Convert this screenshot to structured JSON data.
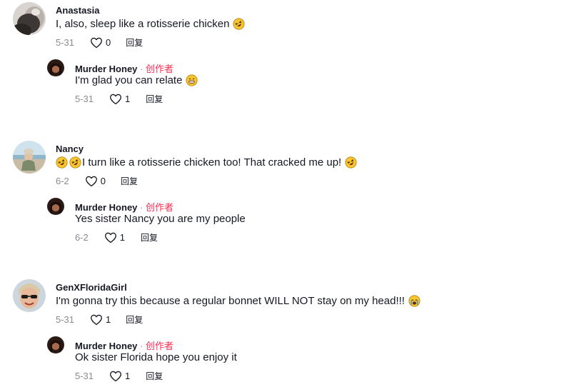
{
  "comments": [
    {
      "username": "Anastasia",
      "text": "I, also, sleep like a rotisserie chicken",
      "date": "5-31",
      "likes": "0",
      "reply_label": "回复",
      "reply": {
        "username": "Murder Honey",
        "separator": " · ",
        "badge": "创作者",
        "text": "I'm glad you can relate",
        "date": "5-31",
        "likes": "1",
        "reply_label": "回复"
      }
    },
    {
      "username": "Nancy",
      "text": "I turn like a rotisserie chicken too! That cracked me up!",
      "date": "6-2",
      "likes": "0",
      "reply_label": "回复",
      "reply": {
        "username": "Murder Honey",
        "separator": " · ",
        "badge": "创作者",
        "text": "Yes sister Nancy you are my people",
        "date": "6-2",
        "likes": "1",
        "reply_label": "回复"
      }
    },
    {
      "username": "GenXFloridaGirl",
      "text": "I'm gonna try this because a regular bonnet WILL NOT stay on my head!!!",
      "date": "5-31",
      "likes": "1",
      "reply_label": "回复",
      "reply": {
        "username": "Murder Honey",
        "separator": " · ",
        "badge": "创作者",
        "text": "Ok sister Florida hope you enjoy it",
        "date": "5-31",
        "likes": "1",
        "reply_label": "回复"
      }
    }
  ],
  "icons": {
    "like": "heart-outline-icon",
    "laughing": "rolling-on-floor-laughing-emoji",
    "grinning": "grinning-emoji",
    "crying": "loudly-crying-emoji"
  },
  "colors": {
    "creator_badge": "#fe2c55",
    "meta_gray": "#8a8b91",
    "text": "#161823"
  }
}
